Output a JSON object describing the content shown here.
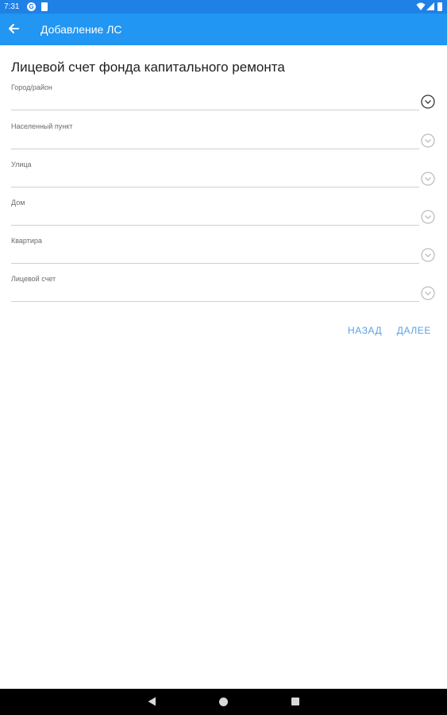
{
  "status_bar": {
    "time": "7:31",
    "notification_icon_letter": "G"
  },
  "app_bar": {
    "title": "Добавление ЛС",
    "color": "#2196f3"
  },
  "form": {
    "title": "Лицевой счет фонда капитального ремонта",
    "fields": [
      {
        "label": "Город/район",
        "value": "",
        "dropdown": "active"
      },
      {
        "label": "Населенный пункт",
        "value": "",
        "dropdown": "disabled"
      },
      {
        "label": "Улица",
        "value": "",
        "dropdown": "disabled"
      },
      {
        "label": "Дом",
        "value": "",
        "dropdown": "disabled"
      },
      {
        "label": "Квартира",
        "value": "",
        "dropdown": "disabled"
      },
      {
        "label": "Лицевой счет",
        "value": "",
        "dropdown": "disabled"
      }
    ]
  },
  "actions": {
    "back_label": "НАЗАД",
    "next_label": "ДАЛЕЕ",
    "color": "#5a9fe6"
  },
  "icons": {
    "back": "arrow-left-icon",
    "dropdown": "chevron-down-circle-icon",
    "nav_back": "triangle-back-icon",
    "nav_home": "circle-home-icon",
    "nav_recents": "square-recents-icon"
  }
}
